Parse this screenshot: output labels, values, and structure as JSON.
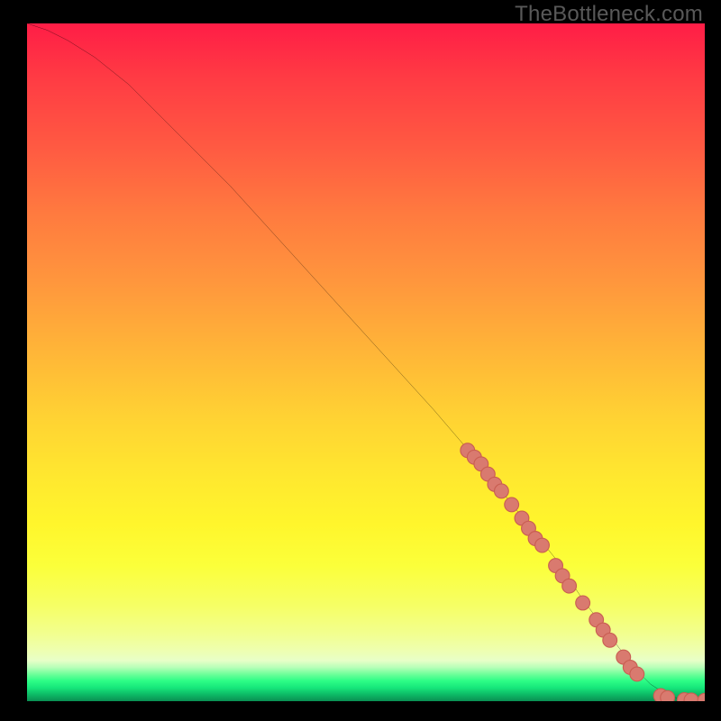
{
  "watermark": "TheBottleneck.com",
  "colors": {
    "background": "#000000",
    "curve": "#000000",
    "marker_fill": "#d97a6f",
    "marker_stroke": "#c95e52"
  },
  "chart_data": {
    "type": "line",
    "title": "",
    "xlabel": "",
    "ylabel": "",
    "xlim": [
      0,
      100
    ],
    "ylim": [
      0,
      100
    ],
    "grid": false,
    "legend": false,
    "series": [
      {
        "name": "bottleneck-curve",
        "x": [
          0,
          3,
          6,
          10,
          15,
          20,
          30,
          40,
          50,
          60,
          66,
          70,
          74,
          78,
          82,
          85,
          88,
          90,
          92,
          94,
          96,
          98,
          100
        ],
        "y": [
          100,
          99,
          97.5,
          95,
          91,
          86,
          76,
          65,
          54,
          43,
          36,
          31,
          26,
          21,
          15,
          11,
          7,
          4.5,
          2.5,
          1.2,
          0.4,
          0.1,
          0.0
        ]
      }
    ],
    "markers": [
      {
        "x": 65,
        "y": 37
      },
      {
        "x": 66,
        "y": 36
      },
      {
        "x": 67,
        "y": 35
      },
      {
        "x": 68,
        "y": 33.5
      },
      {
        "x": 69,
        "y": 32
      },
      {
        "x": 70,
        "y": 31
      },
      {
        "x": 71.5,
        "y": 29
      },
      {
        "x": 73,
        "y": 27
      },
      {
        "x": 74,
        "y": 25.5
      },
      {
        "x": 75,
        "y": 24
      },
      {
        "x": 76,
        "y": 23
      },
      {
        "x": 78,
        "y": 20
      },
      {
        "x": 79,
        "y": 18.5
      },
      {
        "x": 80,
        "y": 17
      },
      {
        "x": 82,
        "y": 14.5
      },
      {
        "x": 84,
        "y": 12
      },
      {
        "x": 85,
        "y": 10.5
      },
      {
        "x": 86,
        "y": 9
      },
      {
        "x": 88,
        "y": 6.5
      },
      {
        "x": 89,
        "y": 5
      },
      {
        "x": 90,
        "y": 4
      },
      {
        "x": 93.5,
        "y": 0.8
      },
      {
        "x": 94.5,
        "y": 0.5
      },
      {
        "x": 97,
        "y": 0.2
      },
      {
        "x": 98,
        "y": 0.15
      },
      {
        "x": 100,
        "y": 0.1
      }
    ]
  }
}
